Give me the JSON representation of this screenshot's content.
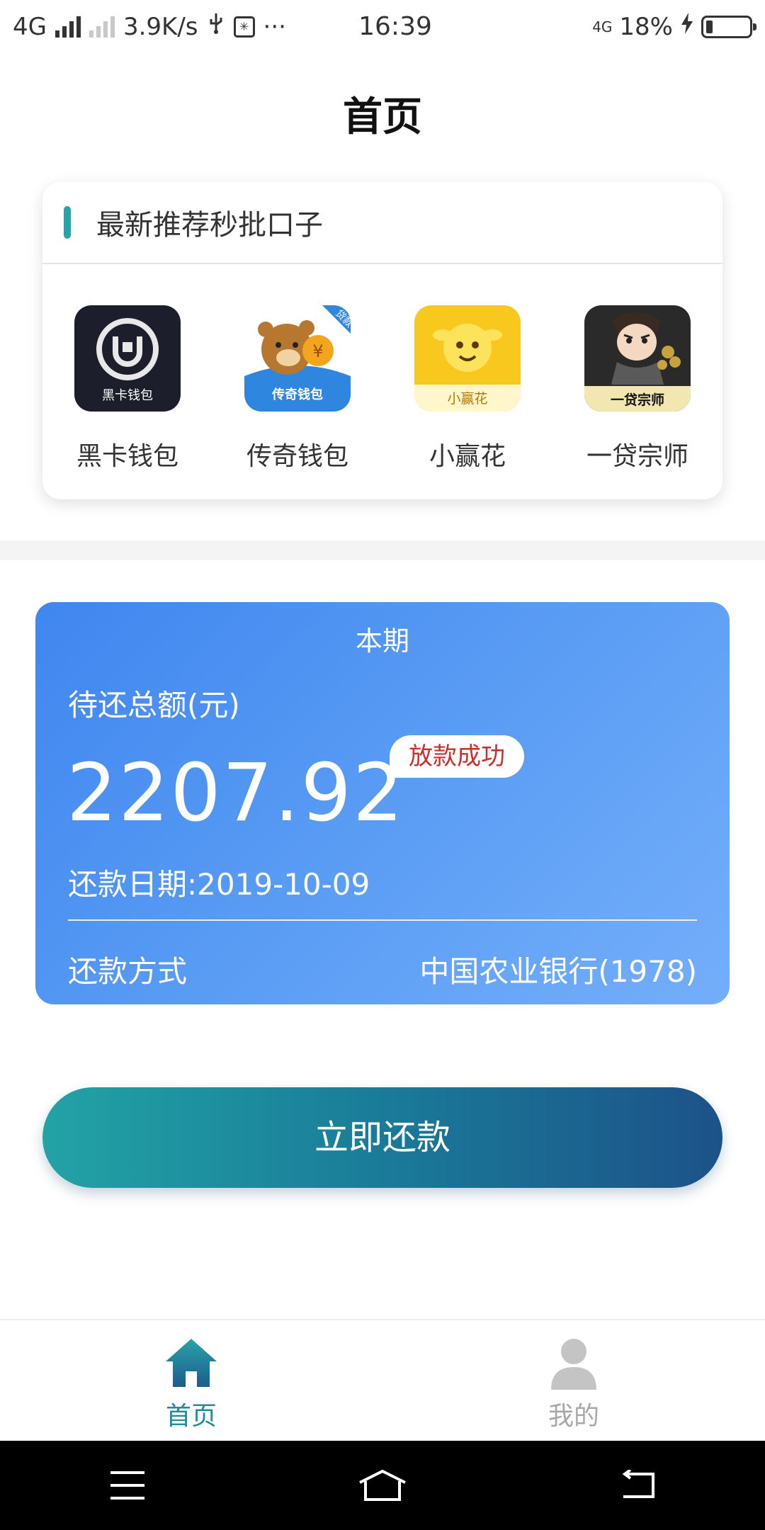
{
  "status_bar": {
    "network": "4G",
    "speed": "3.9K/s",
    "more": "···",
    "time": "16:39",
    "network_right": "4G",
    "battery": "18%"
  },
  "header": {
    "title": "首页"
  },
  "recommend": {
    "title": "最新推荐秒批口子",
    "apps": [
      {
        "label": "黑卡钱包",
        "icon_text": "黑卡钱包",
        "icon": "black-card-wallet-icon"
      },
      {
        "label": "传奇钱包",
        "icon_text": "传奇钱包",
        "corner": "贷款",
        "coin": "¥",
        "icon": "legend-wallet-bear-icon"
      },
      {
        "label": "小赢花",
        "icon_text": "小赢花",
        "icon": "xiaoyinghua-cow-icon"
      },
      {
        "label": "一贷宗师",
        "icon_text": "一贷宗师",
        "icon": "yidai-master-character-icon"
      }
    ]
  },
  "bill": {
    "period": "本期",
    "amount_label": "待还总额(元)",
    "amount": "2207.92",
    "badge": "放款成功",
    "due_date": "还款日期:2019-10-09",
    "method_label": "还款方式",
    "bank": "中国农业银行(1978)",
    "colors": {
      "start": "#3f86ef",
      "end": "#74aefa"
    }
  },
  "pay_button": {
    "label": "立即还款"
  },
  "tabbar": {
    "tabs": [
      {
        "label": "首页",
        "icon": "home-icon",
        "active": true
      },
      {
        "label": "我的",
        "icon": "profile-icon",
        "active": false
      }
    ],
    "active_color": "#1f8aa0"
  },
  "navbar": {
    "keys": [
      "menu-icon",
      "home-key-icon",
      "back-icon"
    ]
  }
}
